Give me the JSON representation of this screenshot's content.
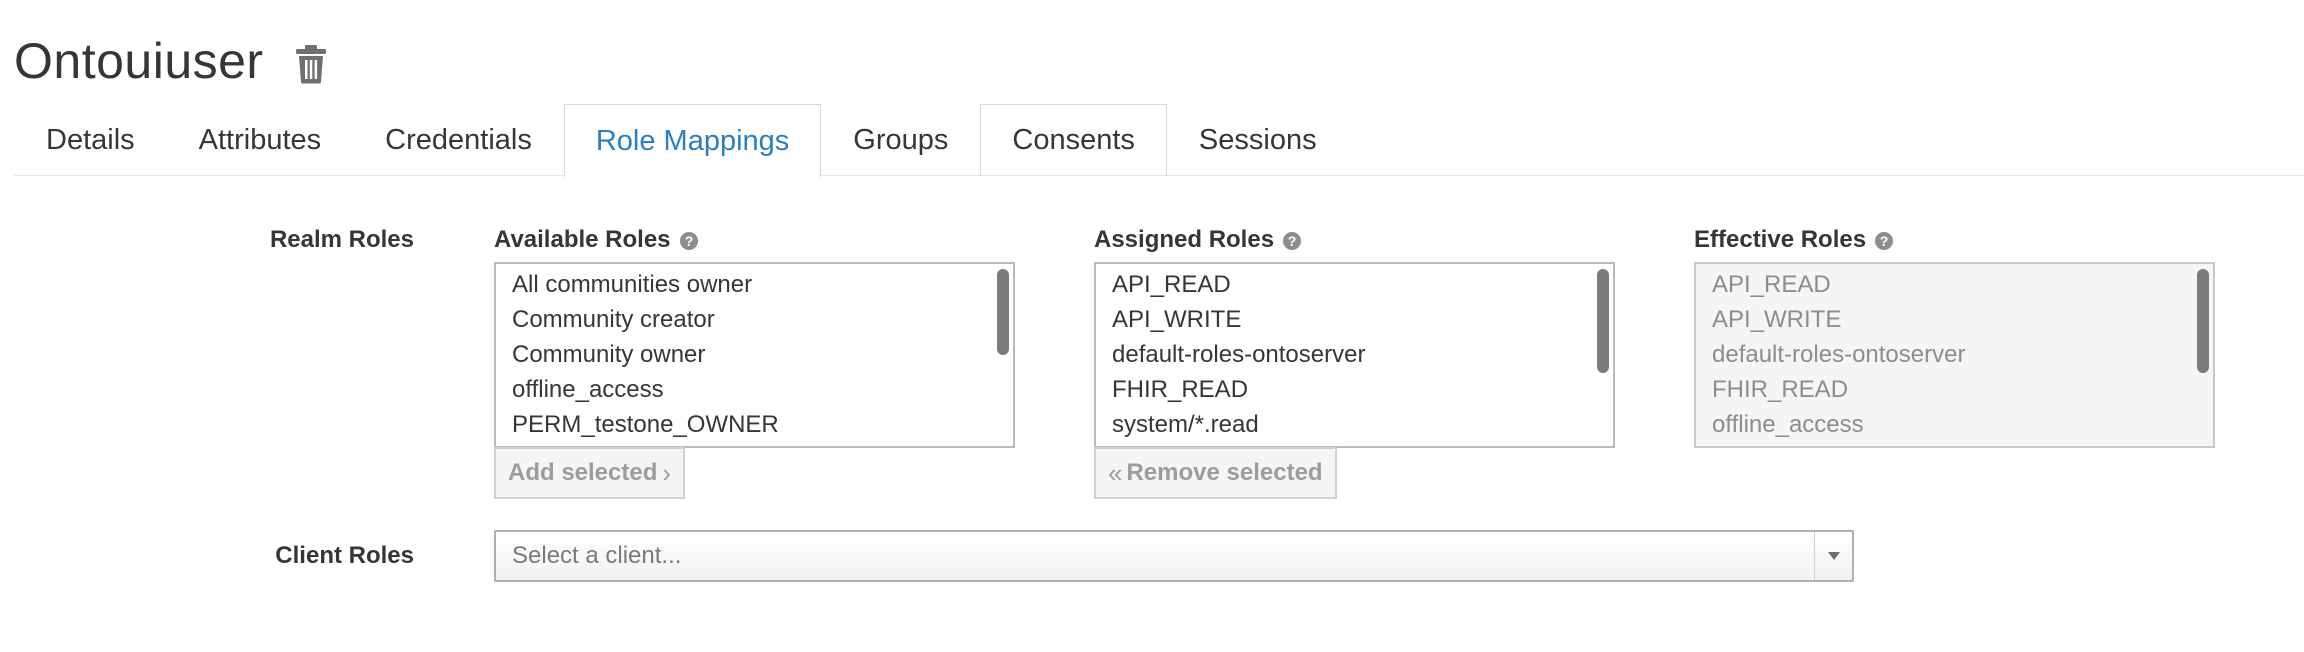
{
  "header": {
    "title": "Ontouiuser",
    "delete_icon": "trash-icon"
  },
  "tabs": [
    {
      "label": "Details",
      "active": false
    },
    {
      "label": "Attributes",
      "active": false
    },
    {
      "label": "Credentials",
      "active": false
    },
    {
      "label": "Role Mappings",
      "active": true
    },
    {
      "label": "Groups",
      "active": false
    },
    {
      "label": "Consents",
      "active": false
    },
    {
      "label": "Sessions",
      "active": false
    }
  ],
  "realm_roles": {
    "label": "Realm Roles",
    "available": {
      "label": "Available Roles",
      "help_icon": "question-circle-icon",
      "items": [
        "All communities owner",
        "Community creator",
        "Community owner",
        "offline_access",
        "PERM_testone_OWNER"
      ],
      "button_label": "Add selected",
      "button_chevron": "›"
    },
    "assigned": {
      "label": "Assigned Roles",
      "help_icon": "question-circle-icon",
      "items": [
        "API_READ",
        "API_WRITE",
        "default-roles-ontoserver",
        "FHIR_READ",
        "system/*.read"
      ],
      "button_label": "Remove selected",
      "button_chevron": "«"
    },
    "effective": {
      "label": "Effective Roles",
      "help_icon": "question-circle-icon",
      "items": [
        "API_READ",
        "API_WRITE",
        "default-roles-ontoserver",
        "FHIR_READ",
        "offline_access"
      ]
    }
  },
  "client_roles": {
    "label": "Client Roles",
    "select_placeholder": "Select a client..."
  },
  "colors": {
    "active_tab": "#2b7fbf",
    "text": "#363636",
    "muted_text": "#8b8d8f",
    "button_text": "#9c9c9c"
  }
}
